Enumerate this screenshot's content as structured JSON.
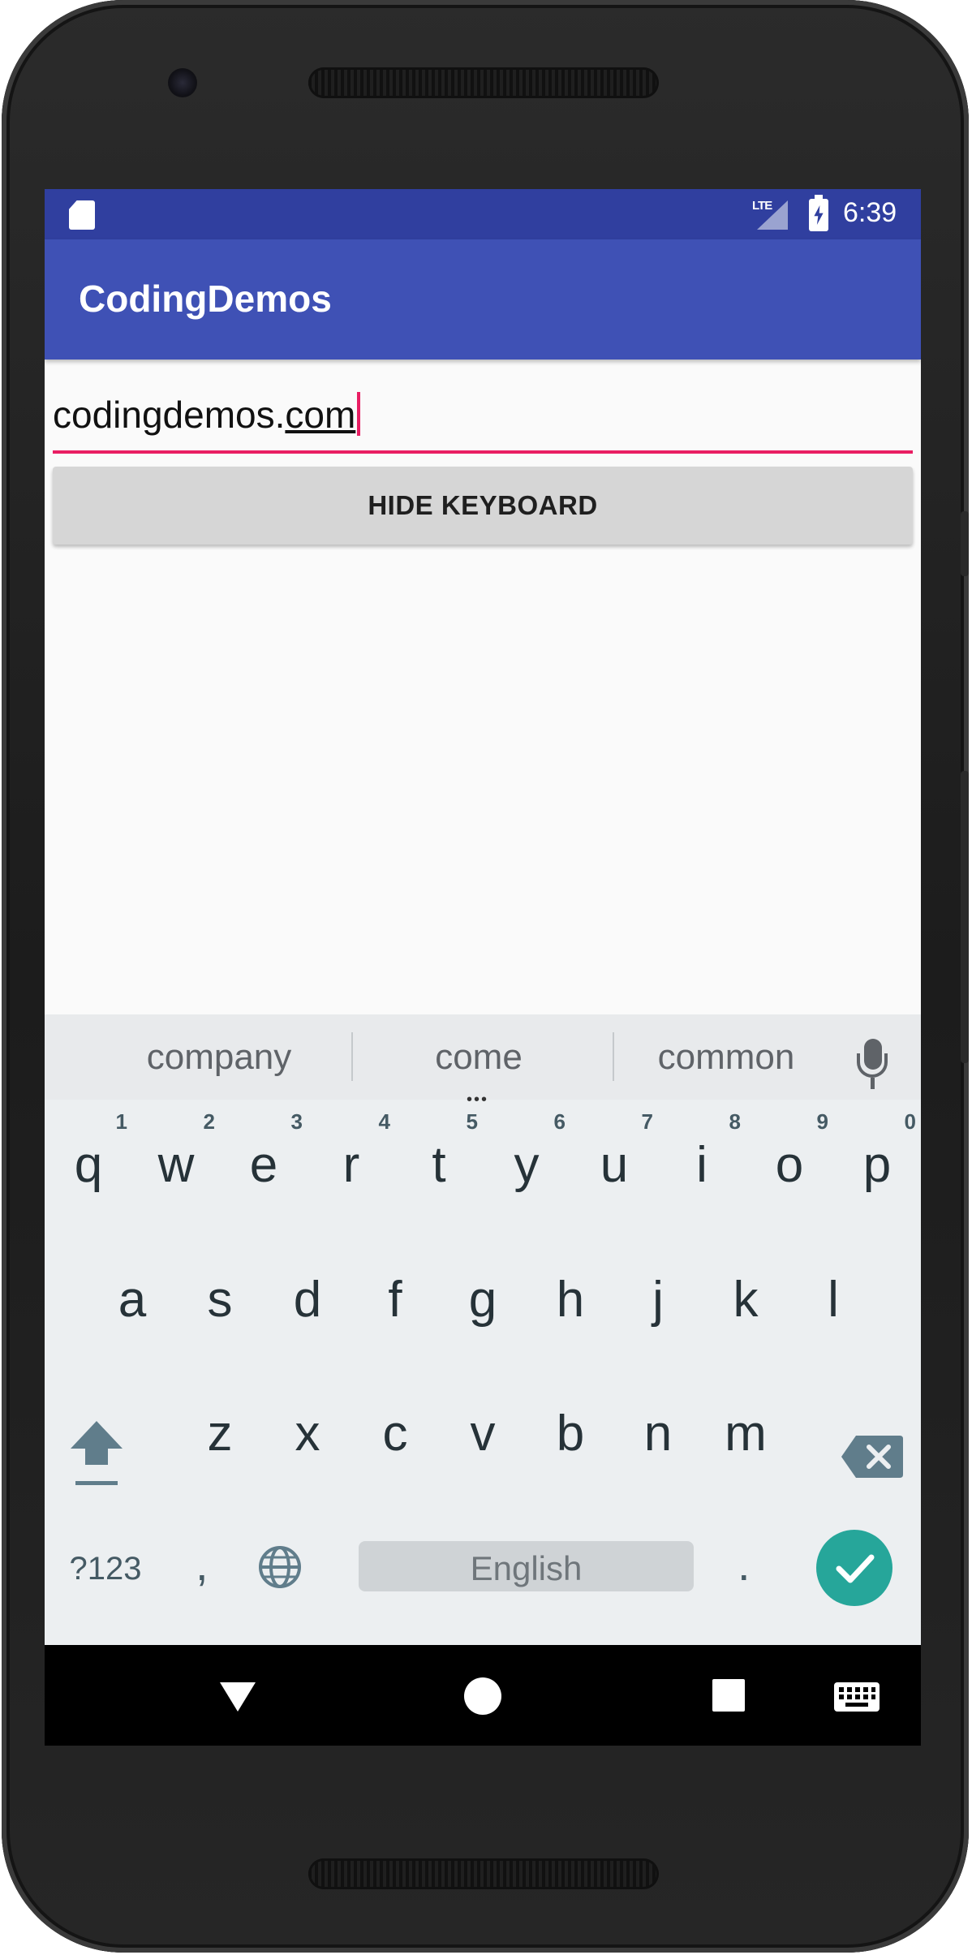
{
  "status_bar": {
    "time": "6:39",
    "network": "LTE"
  },
  "app_bar": {
    "title": "CodingDemos"
  },
  "edit_text": {
    "prefix": "codingdemos.",
    "composing": "com"
  },
  "button": {
    "label": "HIDE KEYBOARD"
  },
  "suggestions": [
    "company",
    "come",
    "common"
  ],
  "keyboard": {
    "row1": [
      {
        "char": "q",
        "num": "1"
      },
      {
        "char": "w",
        "num": "2"
      },
      {
        "char": "e",
        "num": "3"
      },
      {
        "char": "r",
        "num": "4"
      },
      {
        "char": "t",
        "num": "5"
      },
      {
        "char": "y",
        "num": "6"
      },
      {
        "char": "u",
        "num": "7"
      },
      {
        "char": "i",
        "num": "8"
      },
      {
        "char": "o",
        "num": "9"
      },
      {
        "char": "p",
        "num": "0"
      }
    ],
    "row2": [
      "a",
      "s",
      "d",
      "f",
      "g",
      "h",
      "j",
      "k",
      "l"
    ],
    "row3": [
      "z",
      "x",
      "c",
      "v",
      "b",
      "n",
      "m"
    ],
    "symbols_label": "?123",
    "comma": ",",
    "space_label": "English",
    "period": "."
  },
  "colors": {
    "status_bar": "#303f9f",
    "app_bar": "#3f51b5",
    "accent": "#e91e63",
    "enter_key": "#26a69a"
  }
}
